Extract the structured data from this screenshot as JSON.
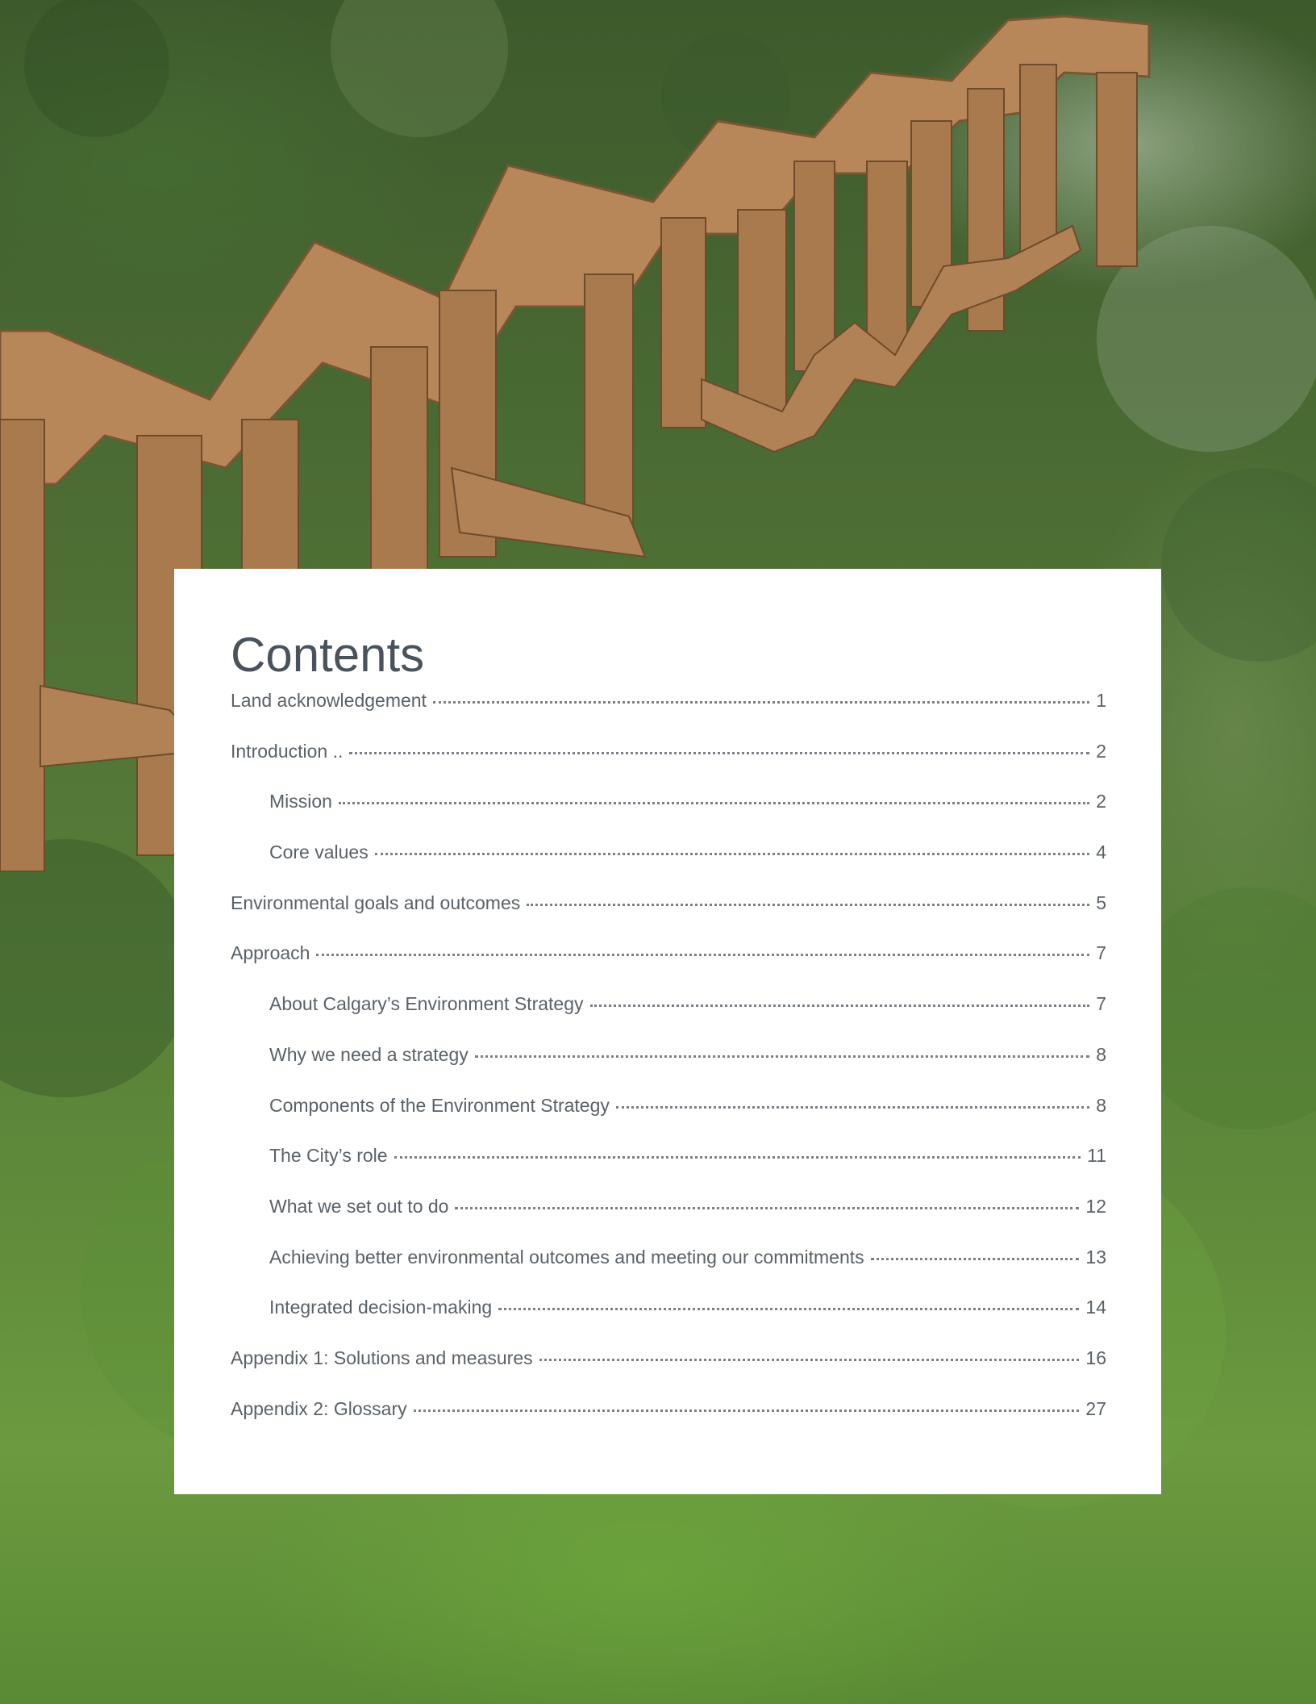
{
  "background": {
    "description_icon": "boardwalk-stairs-photo"
  },
  "contents": {
    "title": "Contents",
    "entries": [
      {
        "label": "Land acknowledgement",
        "page": "1",
        "level": 1
      },
      {
        "label": "Introduction ..",
        "page": "2",
        "level": 1
      },
      {
        "label": "Mission",
        "page": "2",
        "level": 2
      },
      {
        "label": "Core values",
        "page": "4",
        "level": 2
      },
      {
        "label": "Environmental goals and outcomes",
        "page": "5",
        "level": 1
      },
      {
        "label": "Approach",
        "page": "7",
        "level": 1
      },
      {
        "label": "About Calgary’s Environment Strategy",
        "page": "7",
        "level": 2
      },
      {
        "label": "Why we need a strategy",
        "page": "8",
        "level": 2
      },
      {
        "label": "Components of the Environment Strategy",
        "page": "8",
        "level": 2
      },
      {
        "label": "The City’s role",
        "page": "11",
        "level": 2
      },
      {
        "label": "What we set out to do",
        "page": "12",
        "level": 2
      },
      {
        "label": "Achieving better environmental outcomes and meeting our commitments",
        "page": "13",
        "level": 2
      },
      {
        "label": "Integrated decision-making",
        "page": "14",
        "level": 2
      },
      {
        "label": "Appendix 1: Solutions and measures",
        "page": "16",
        "level": 1
      },
      {
        "label": "Appendix 2: Glossary",
        "page": "27",
        "level": 1
      }
    ]
  }
}
